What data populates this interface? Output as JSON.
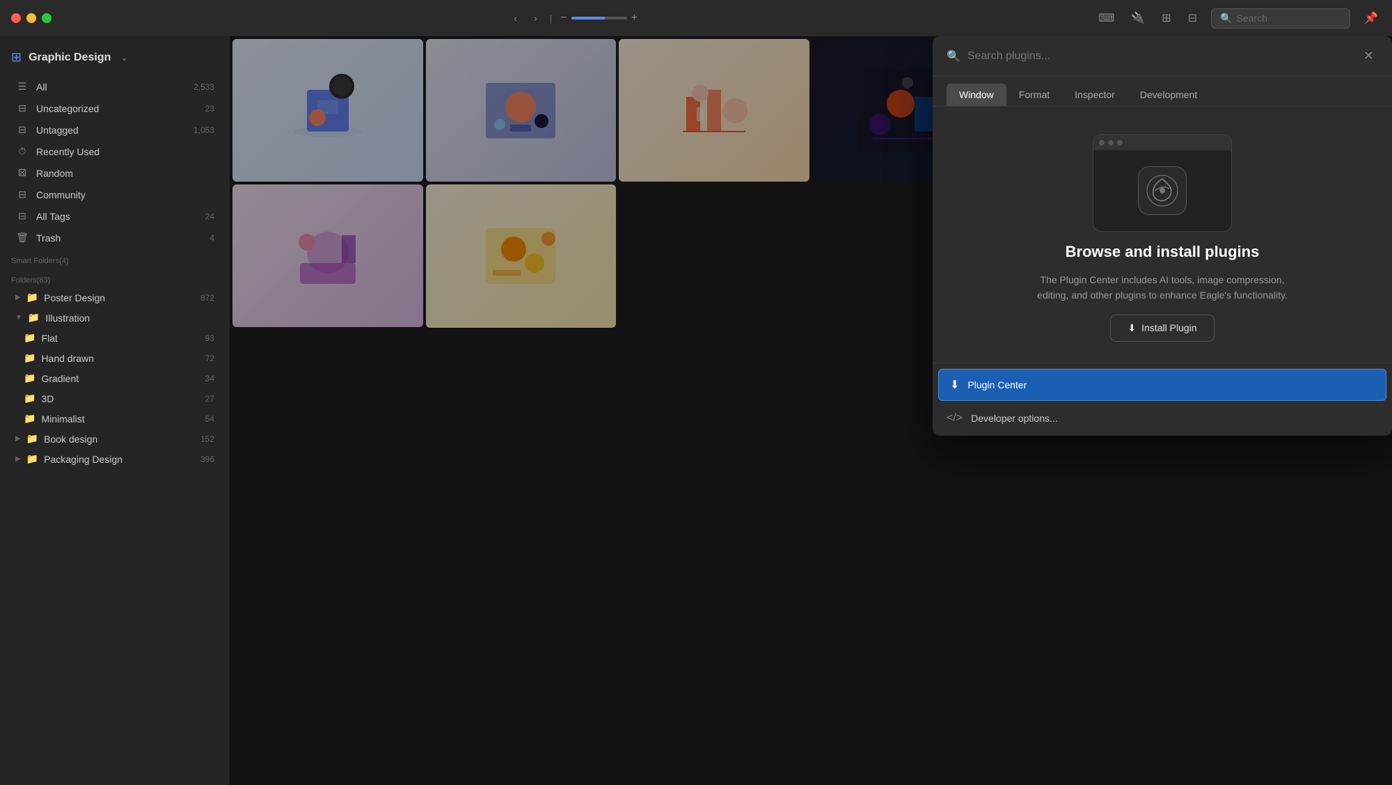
{
  "app": {
    "title": "Graphic Design",
    "traffic_lights": {
      "red": "close",
      "yellow": "minimize",
      "green": "maximize"
    }
  },
  "titlebar": {
    "nav_back": "‹",
    "nav_forward": "›",
    "nav_separator": "|",
    "zoom_minus": "−",
    "zoom_plus": "+",
    "search_placeholder": "Search"
  },
  "sidebar": {
    "workspace_title": "Graphic Design",
    "items": [
      {
        "id": "all",
        "icon": "☰",
        "label": "All",
        "count": "2,533"
      },
      {
        "id": "uncategorized",
        "icon": "⊟",
        "label": "Uncategorized",
        "count": "23"
      },
      {
        "id": "untagged",
        "icon": "⊟",
        "label": "Untagged",
        "count": "1,053"
      },
      {
        "id": "recently-used",
        "icon": "⏱",
        "label": "Recently Used",
        "count": ""
      },
      {
        "id": "random",
        "icon": "⚄",
        "label": "Random",
        "count": ""
      },
      {
        "id": "community",
        "icon": "⊟",
        "label": "Community",
        "count": ""
      },
      {
        "id": "all-tags",
        "icon": "⊟",
        "label": "All Tags",
        "count": "24"
      },
      {
        "id": "trash",
        "icon": "🗑",
        "label": "Trash",
        "count": "4"
      }
    ],
    "smart_folders_label": "Smart Folders(4)",
    "folders_label": "Folders(63)",
    "folders": [
      {
        "id": "poster-design",
        "icon": "📁",
        "color": "#e74c3c",
        "label": "Poster Design",
        "count": "872",
        "expanded": false
      },
      {
        "id": "illustration",
        "icon": "📁",
        "color": "#9b59b6",
        "label": "Illustration",
        "count": "",
        "expanded": true,
        "children": [
          {
            "id": "flat",
            "icon": "📁",
            "color": "#3498db",
            "label": "Flat",
            "count": "93"
          },
          {
            "id": "hand-drawn",
            "icon": "📁",
            "color": "#3498db",
            "label": "Hand drawn",
            "count": "72"
          },
          {
            "id": "gradient",
            "icon": "📁",
            "color": "#3498db",
            "label": "Gradient",
            "count": "34"
          },
          {
            "id": "3d",
            "icon": "📁",
            "color": "#3498db",
            "label": "3D",
            "count": "27"
          },
          {
            "id": "minimalist",
            "icon": "📁",
            "color": "#3498db",
            "label": "Minimalist",
            "count": "54"
          }
        ]
      },
      {
        "id": "book-design",
        "icon": "📁",
        "color": "#2ecc71",
        "label": "Book design",
        "count": "152",
        "expanded": false
      },
      {
        "id": "packaging-design",
        "icon": "📁",
        "color": "#2ecc71",
        "label": "Packaging Design",
        "count": "396",
        "expanded": false
      }
    ]
  },
  "plugin_panel": {
    "search_placeholder": "Search plugins...",
    "tabs": [
      {
        "id": "window",
        "label": "Window",
        "active": true
      },
      {
        "id": "format",
        "label": "Format",
        "active": false
      },
      {
        "id": "inspector",
        "label": "Inspector",
        "active": false
      },
      {
        "id": "development",
        "label": "Development",
        "active": false
      }
    ],
    "logo_icon": "🦅",
    "main_title": "Browse and install plugins",
    "description": "The Plugin Center includes AI tools, image compression, editing, and other plugins to enhance Eagle's functionality.",
    "install_button": "Install Plugin",
    "menu_items": [
      {
        "id": "plugin-center",
        "icon": "⬇",
        "label": "Plugin Center",
        "highlighted": true
      },
      {
        "id": "developer-options",
        "icon": "</>",
        "label": "Developer options...",
        "highlighted": false
      }
    ],
    "close_btn": "✕"
  }
}
